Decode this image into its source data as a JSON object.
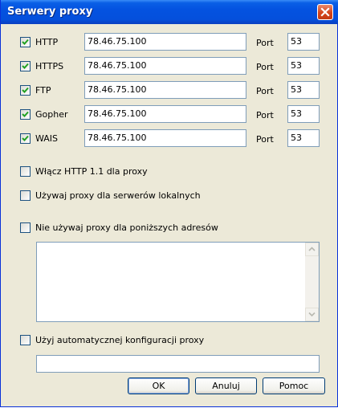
{
  "window": {
    "title": "Serwery proxy"
  },
  "proxies": [
    {
      "protocol": "HTTP",
      "checked": true,
      "address": "78.46.75.100",
      "port_label": "Port",
      "port": "53"
    },
    {
      "protocol": "HTTPS",
      "checked": true,
      "address": "78.46.75.100",
      "port_label": "Port",
      "port": "53"
    },
    {
      "protocol": "FTP",
      "checked": true,
      "address": "78.46.75.100",
      "port_label": "Port",
      "port": "53"
    },
    {
      "protocol": "Gopher",
      "checked": true,
      "address": "78.46.75.100",
      "port_label": "Port",
      "port": "53"
    },
    {
      "protocol": "WAIS",
      "checked": true,
      "address": "78.46.75.100",
      "port_label": "Port",
      "port": "53"
    }
  ],
  "options": {
    "http11": {
      "label": "Włącz HTTP 1.1 dla proxy",
      "checked": false
    },
    "local": {
      "label": "Używaj proxy dla serwerów lokalnych",
      "checked": false
    },
    "bypass": {
      "label": "Nie używaj proxy dla poniższych adresów",
      "checked": false,
      "value": ""
    },
    "autoconfig": {
      "label": "Użyj automatycznej konfiguracji proxy",
      "checked": false,
      "value": ""
    }
  },
  "buttons": {
    "ok": "OK",
    "cancel": "Anuluj",
    "help": "Pomoc"
  }
}
